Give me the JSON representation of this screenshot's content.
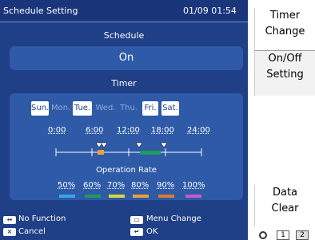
{
  "header": {
    "title": "Schedule Setting",
    "datetime": "01/09 01:54"
  },
  "schedule": {
    "title": "Schedule",
    "value": "On"
  },
  "timer": {
    "title": "Timer",
    "days": [
      {
        "label": "Sun.",
        "selected": true
      },
      {
        "label": "Mon.",
        "selected": false
      },
      {
        "label": "Tue.",
        "selected": true
      },
      {
        "label": "Wed.",
        "selected": false
      },
      {
        "label": "Thu.",
        "selected": false
      },
      {
        "label": "Fri.",
        "selected": true
      },
      {
        "label": "Sat.",
        "selected": true
      }
    ],
    "time_ticks": [
      "0:00",
      "6:00",
      "12:00",
      "18:00",
      "24:00"
    ],
    "rate_title": "Operation Rate",
    "rates": [
      {
        "label": "50%",
        "color": "#35a7e8"
      },
      {
        "label": "60%",
        "color": "#1f9a5a"
      },
      {
        "label": "70%",
        "color": "#d8d83a"
      },
      {
        "label": "80%",
        "color": "#e9a13a"
      },
      {
        "label": "90%",
        "color": "#e07a2b"
      },
      {
        "label": "100%",
        "color": "#c05fc7"
      }
    ]
  },
  "footer": {
    "left_top": "No Function",
    "left_bottom": "Cancel",
    "right_top": "Menu Change",
    "right_bottom": "OK"
  },
  "side_buttons": {
    "timer_change": [
      "Timer",
      "Change"
    ],
    "on_off_setting": [
      "On/Off",
      "Setting"
    ],
    "data_clear": [
      "Data",
      "Clear"
    ]
  },
  "pages": [
    "1",
    "2"
  ]
}
